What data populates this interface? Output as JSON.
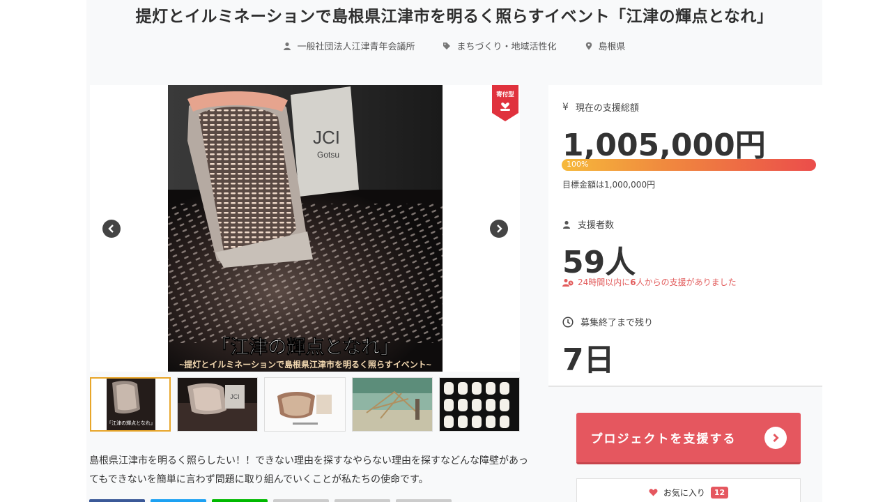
{
  "project": {
    "title": "提灯とイルミネーションで島根県江津市を明るく照らすイベント「江津の輝点となれ」",
    "organizer": "一般社団法人江津青年会議所",
    "category": "まちづくり・地域活性化",
    "location": "島根県"
  },
  "gallery": {
    "badge_label": "寄付型",
    "photo_caption": "「江津の輝点となれ」",
    "photo_subcaption": "~提灯とイルミネーションで島根県江津市を明るく照らすイベント~",
    "lantern_logo": "JCI",
    "lantern_logo_sub": "Gotsu",
    "thumbnails": [
      {
        "name": "thumb-1",
        "caption": "「江津の輝点となれ」"
      },
      {
        "name": "thumb-2",
        "caption": ""
      },
      {
        "name": "thumb-3",
        "caption": ""
      },
      {
        "name": "thumb-4",
        "caption": ""
      },
      {
        "name": "thumb-5",
        "caption": ""
      }
    ]
  },
  "description": "島根県江津市を明るく照らしたい！！できない理由を探すなやらない理由を探すなどんな障壁があってもできないを簡単に言わず問題に取り組んでいくことが私たちの使命です。",
  "stats": {
    "total_label": "現在の支援総額",
    "total_value": "1,005,000円",
    "progress_label": "100%",
    "progress_fraction": 1.0,
    "goal_text": "目標金額は1,000,000円",
    "supporters_label": "支援者数",
    "supporters_value": "59人",
    "recent_text_before": "24時間以内に",
    "recent_count": "6",
    "recent_text_after": "人からの支援がありました",
    "remaining_label": "募集終了まで残り",
    "remaining_value": "7日",
    "currency_symbol": "¥"
  },
  "actions": {
    "support_label": "プロジェクトを支援する",
    "favorite_label": "お気に入り",
    "favorite_count": "12"
  },
  "colors": {
    "accent": "#e5575f",
    "progress_start": "#f6b93b",
    "progress_end": "#eb4d4b",
    "thumb_active_border": "#e8a62a",
    "share_colors": [
      "#3b5998",
      "#1da1f2",
      "#00b900",
      "#cccccc",
      "#cccccc",
      "#cccccc"
    ]
  },
  "icons": {
    "organizer": "user-icon",
    "category": "tag-icon",
    "location": "map-pin-icon",
    "prev": "chevron-left-icon",
    "next": "chevron-right-icon",
    "supporters": "user-icon",
    "recent": "users-icon",
    "remaining": "clock-icon",
    "support_arrow": "chevron-right-icon",
    "favorite": "heart-icon"
  }
}
